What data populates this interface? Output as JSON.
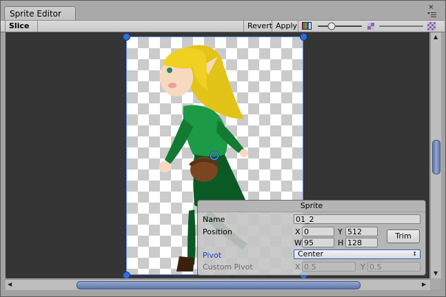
{
  "window": {
    "tab_title": "Sprite Editor",
    "close_glyph": "×"
  },
  "toolbar": {
    "slice_label": "Slice",
    "slice_arrows": "↕",
    "revert_label": "Revert",
    "apply_label": "Apply"
  },
  "sprite_panel": {
    "title": "Sprite",
    "name_label": "Name",
    "name_value": "01_2",
    "position_label": "Position",
    "x_label": "X",
    "x_value": "0",
    "y_label": "Y",
    "y_value": "512",
    "w_label": "W",
    "w_value": "95",
    "h_label": "H",
    "h_value": "128",
    "trim_label": "Trim",
    "pivot_label": "Pivot",
    "pivot_value": "Center",
    "pivot_arrow": "↕",
    "custom_pivot_label": "Custom Pivot",
    "custom_x_label": "X",
    "custom_x_value": "0.5",
    "custom_y_label": "Y",
    "custom_y_value": "0.5"
  },
  "colors": {
    "accent_blue": "#2f6fdd",
    "pivot_label_blue": "#1a3fbf",
    "canvas_bg": "#353535"
  }
}
